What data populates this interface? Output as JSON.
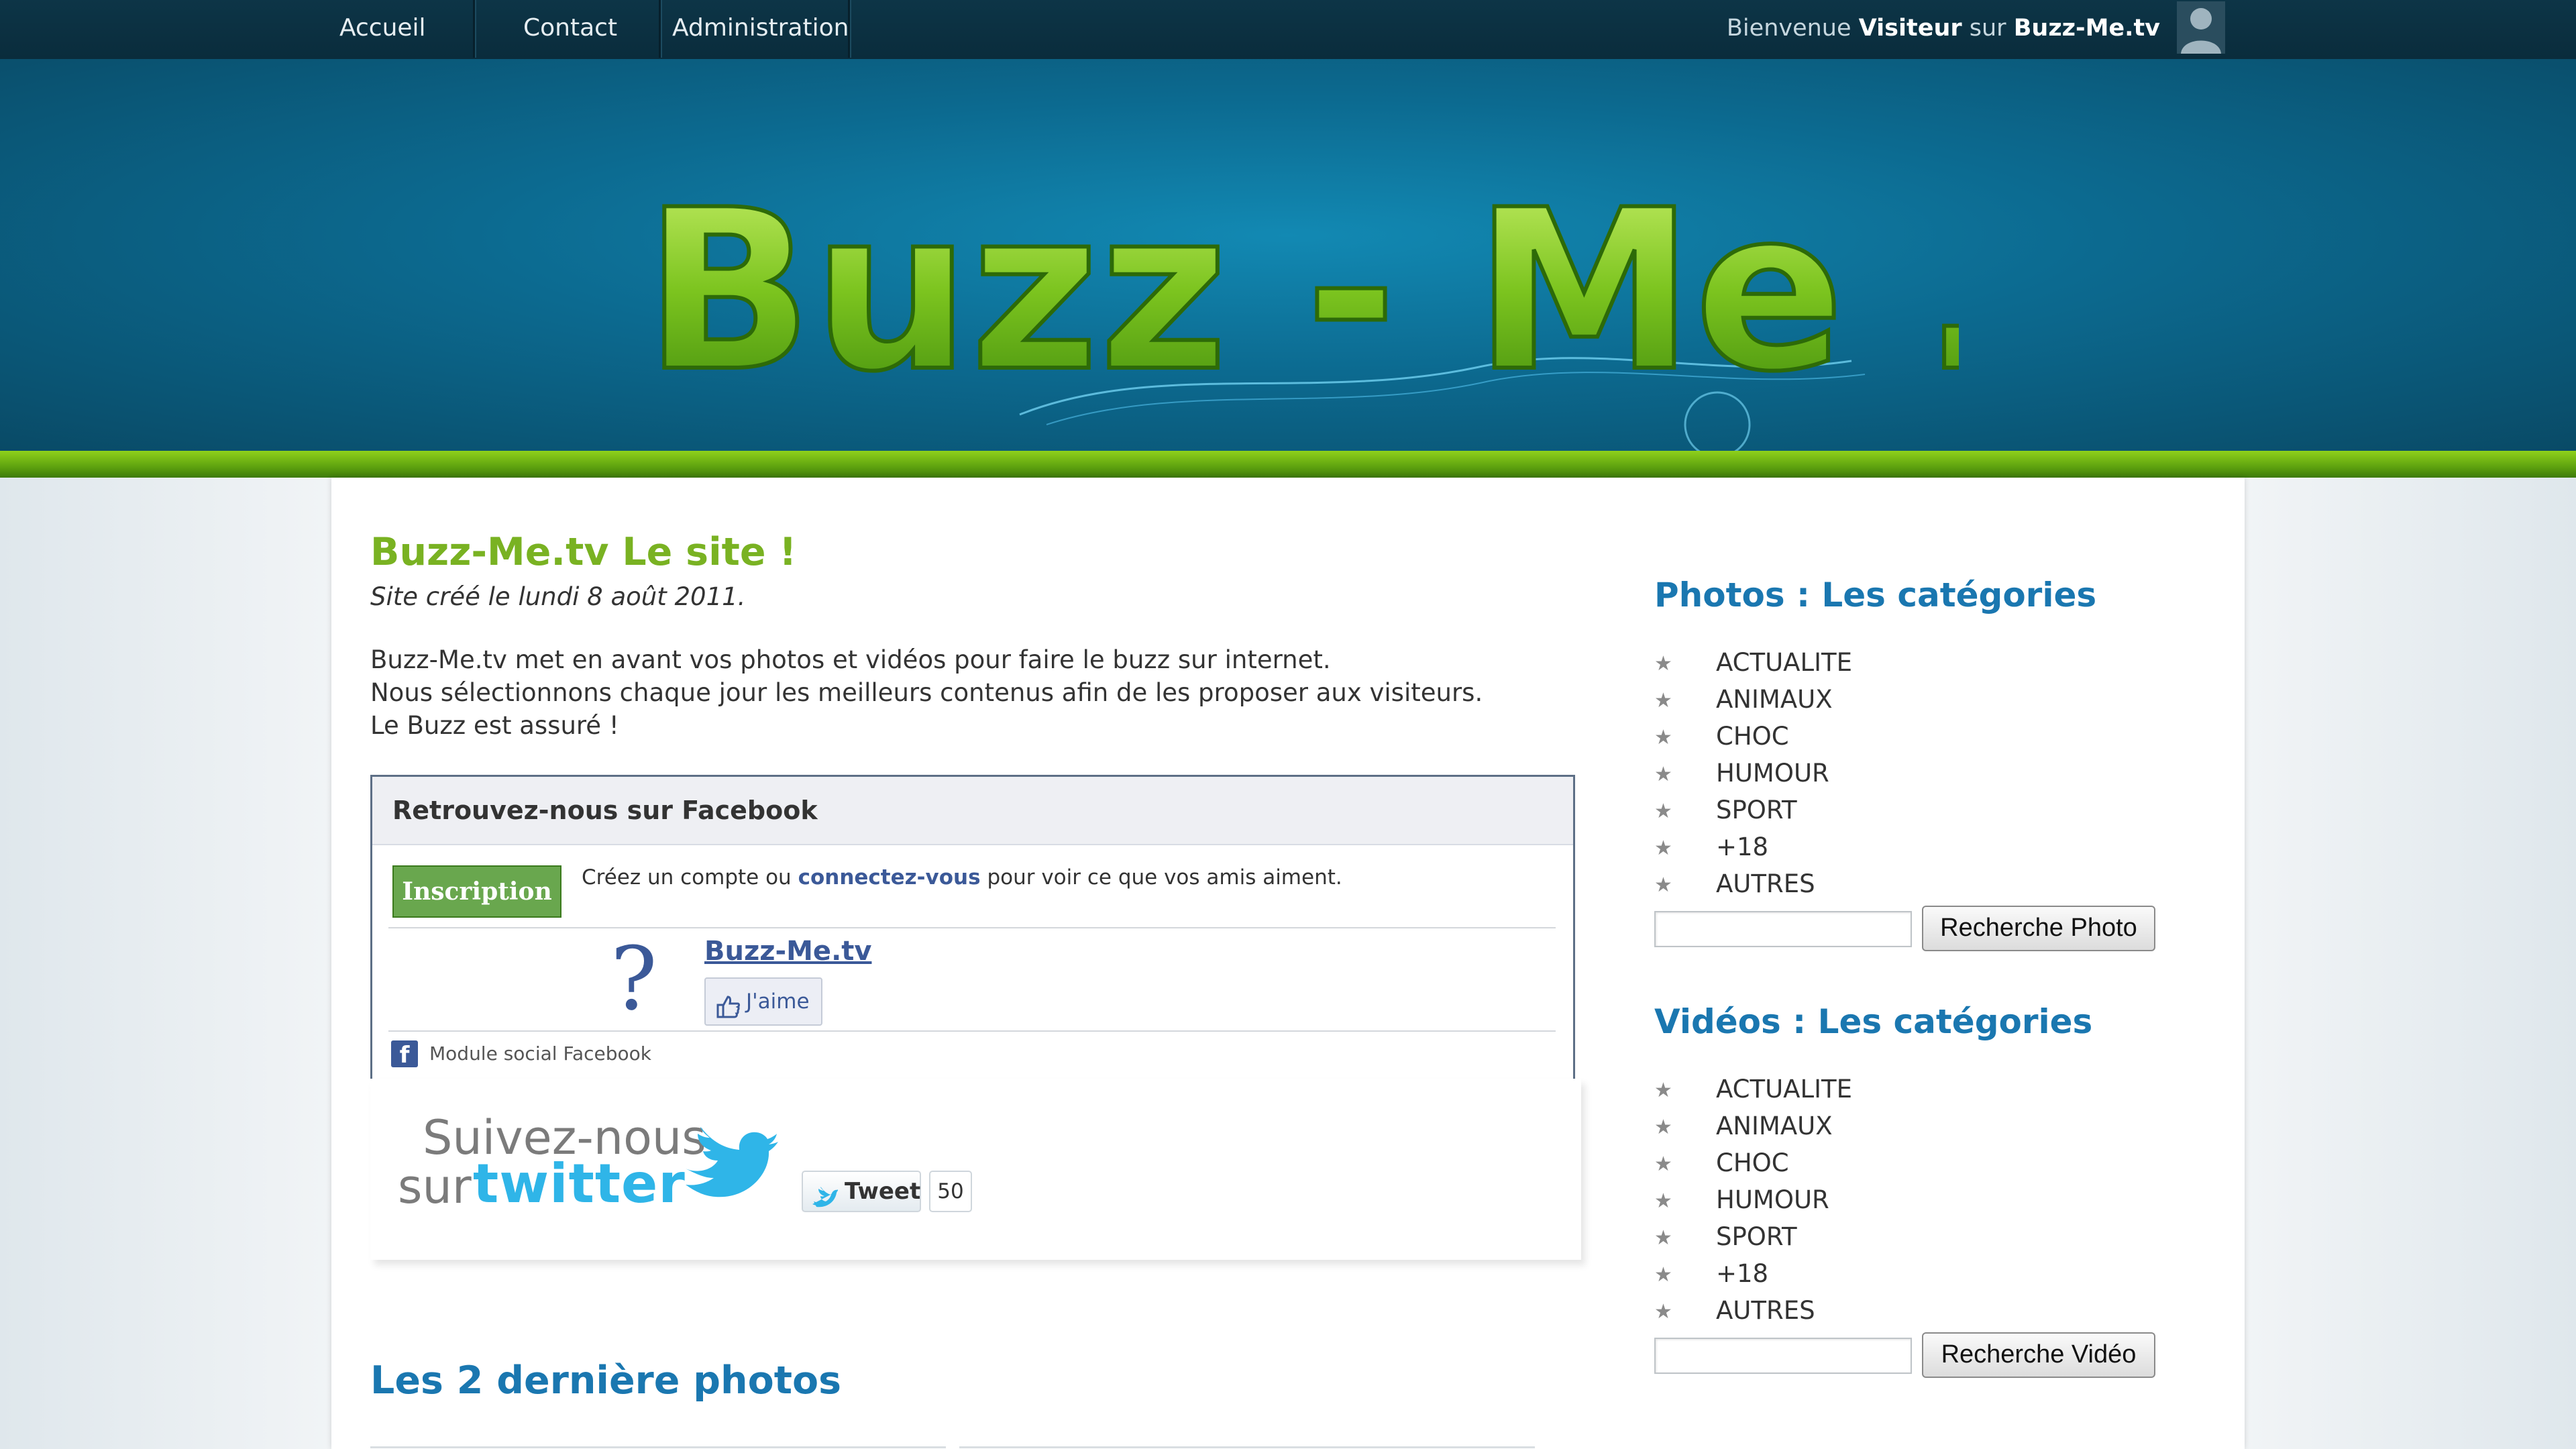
{
  "nav": {
    "items": [
      {
        "label": "Accueil"
      },
      {
        "label": "Contact"
      },
      {
        "label": "Administration"
      }
    ],
    "welcome_prefix": "Bienvenue",
    "welcome_user": "Visiteur",
    "welcome_mid": "sur",
    "welcome_site": "Buzz-Me.tv"
  },
  "banner": {
    "logo_text": "Buzz - Me . tv"
  },
  "main": {
    "title": "Buzz-Me.tv Le site !",
    "date": "Site créé le lundi 8 août 2011.",
    "intro_lines": [
      "Buzz-Me.tv met en avant vos photos et vidéos pour faire le buzz sur internet.",
      "Nous sélectionnons chaque jour les meilleurs contenus afin de les proposer aux visiteurs.",
      "Le Buzz est assuré !"
    ],
    "facebook": {
      "header": "Retrouvez-nous sur Facebook",
      "signup_button": "Inscription",
      "signup_text_before": "Créez un compte ou",
      "signup_link": "connectez-vous",
      "signup_text_after": "pour voir ce que vos amis aiment.",
      "page_name": "Buzz-Me.tv",
      "like_label": "J'aime",
      "footer": "Module social Facebook"
    },
    "twitter": {
      "follow_line1": "Suivez-nous",
      "follow_line2": "sur",
      "twitter_word": "twitter",
      "tweet_label": "Tweet",
      "tweet_count": "50"
    },
    "latest_photos_title": "Les 2 dernière photos"
  },
  "sidebar": {
    "photos": {
      "title": "Photos : Les catégories",
      "categories": [
        "ACTUALITE",
        "ANIMAUX",
        "CHOC",
        "HUMOUR",
        "SPORT",
        "+18",
        "AUTRES"
      ],
      "search_button": "Recherche Photo"
    },
    "videos": {
      "title": "Vidéos : Les catégories",
      "categories": [
        "ACTUALITE",
        "ANIMAUX",
        "CHOC",
        "HUMOUR",
        "SPORT",
        "+18",
        "AUTRES"
      ],
      "search_button": "Recherche Vidéo"
    }
  },
  "colors": {
    "topbar": "#0b2f40",
    "banner": "#0c6a90",
    "green_band": "#6db313",
    "title_green": "#79b222",
    "heading_blue": "#1a77b0",
    "facebook_blue": "#3b5998",
    "twitter_blue": "#2fb5e8"
  },
  "icons": {
    "user_avatar": "user-silhouette-icon",
    "facebook": "facebook-f-icon",
    "like": "thumbs-up-icon",
    "twitter": "twitter-bird-icon",
    "category_bullet": "star-icon"
  }
}
